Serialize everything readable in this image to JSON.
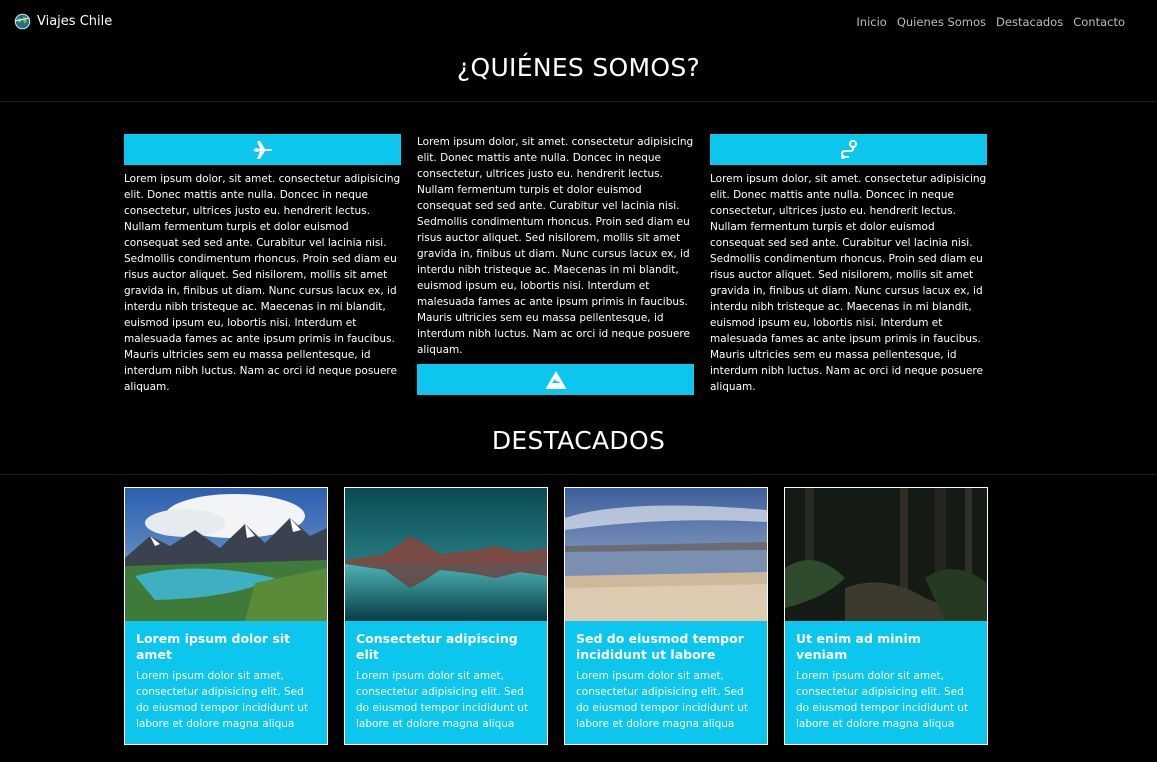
{
  "nav": {
    "brand": "Viajes Chile",
    "links": [
      "Inicio",
      "Quienes Somos",
      "Destacados",
      "Contacto"
    ]
  },
  "about": {
    "title": "¿QUIÉNES SOMOS?",
    "columns": [
      {
        "icon": "airplane-icon",
        "text": "Lorem ipsum dolor, sit amet. consectetur adipisicing elit. Donec mattis ante nulla. Doncec in neque consectetur, ultrices justo eu. hendrerit lectus. Nullam fermentum turpis et dolor euismod consequat sed sed ante. Curabitur vel lacinia nisi. Sedmollis condimentum rhoncus. Proin sed diam eu risus auctor aliquet. Sed nisilorem, mollis sit amet gravida in, finibus ut diam. Nunc cursus lacux ex, id interdu nibh tristeque ac. Maecenas in mi blandit, euismod ipsum eu, lobortis nisi. Interdum et malesuada fames ac ante ipsum primis in faucibus. Mauris ultricies sem eu massa pellentesque, id interdum nibh luctus. Nam ac orci id neque posuere aliquam."
      },
      {
        "icon": "mountain-icon",
        "text": "Lorem ipsum dolor, sit amet. consectetur adipisicing elit. Donec mattis ante nulla. Doncec in neque consectetur, ultrices justo eu. hendrerit lectus. Nullam fermentum turpis et dolor euismod consequat sed sed ante. Curabitur vel lacinia nisi. Sedmollis condimentum rhoncus. Proin sed diam eu risus auctor aliquet. Sed nisilorem, mollis sit amet gravida in, finibus ut diam. Nunc cursus lacux ex, id interdu nibh tristeque ac. Maecenas in mi blandit, euismod ipsum eu, lobortis nisi. Interdum et malesuada fames ac ante ipsum primis in faucibus. Mauris ultricies sem eu massa pellentesque, id interdum nibh luctus. Nam ac orci id neque posuere aliquam."
      },
      {
        "icon": "route-icon",
        "text": "Lorem ipsum dolor, sit amet. consectetur adipisicing elit. Donec mattis ante nulla. Doncec in neque consectetur, ultrices justo eu. hendrerit lectus. Nullam fermentum turpis et dolor euismod consequat sed sed ante. Curabitur vel lacinia nisi. Sedmollis condimentum rhoncus. Proin sed diam eu risus auctor aliquet. Sed nisilorem, mollis sit amet gravida in, finibus ut diam. Nunc cursus lacux ex, id interdu nibh tristeque ac. Maecenas in mi blandit, euismod ipsum eu, lobortis nisi. Interdum et malesuada fames ac ante ipsum primis in faucibus. Mauris ultricies sem eu massa pellentesque, id interdum nibh luctus. Nam ac orci id neque posuere aliquam."
      }
    ]
  },
  "featured": {
    "title": "DESTACADOS",
    "cards": [
      {
        "title": "Lorem ipsum dolor sit amet",
        "text": "Lorem ipsum dolor sit amet, consectetur adipisicing elit. Sed do eiusmod tempor incididunt ut labore et dolore magna aliqua"
      },
      {
        "title": "Consectetur adipiscing elit",
        "text": "Lorem ipsum dolor sit amet, consectetur adipisicing elit. Sed do eiusmod tempor incididunt ut labore et dolore magna aliqua"
      },
      {
        "title": "Sed do eiusmod tempor incididunt ut labore",
        "text": "Lorem ipsum dolor sit amet, consectetur adipisicing elit. Sed do eiusmod tempor incididunt ut labore et dolore magna aliqua"
      },
      {
        "title": "Ut enim ad minim veniam",
        "text": "Lorem ipsum dolor sit amet, consectetur adipisicing elit. Sed do eiusmod tempor incididunt ut labore et dolore magna aliqua"
      }
    ]
  },
  "colors": {
    "accent": "#0cc6ee",
    "background": "#000000",
    "nav_link": "#bdbdbd"
  }
}
